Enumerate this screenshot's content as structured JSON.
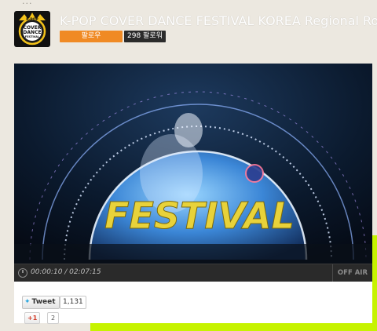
{
  "header": {
    "top_cut_text": "...",
    "channel_title": "K-POP COVER DANCE FESTIVAL KOREA Regional Ro",
    "follow_label": "팔로우",
    "follower_count": "298 팔로워"
  },
  "logo": {
    "text_line1": "K-POP",
    "text_line2": "COVER",
    "text_line3": "DANCE",
    "text_line4": "FESTIVAL",
    "ring_color": "#f2c21a"
  },
  "video": {
    "overlay_text": "FESTIVAL",
    "time": "00:00:10 / 02:07:15",
    "status": "OFF AIR"
  },
  "social": {
    "tweet_label": "Tweet",
    "tweet_count": "1,131",
    "gplus_label": "+1",
    "gplus_count": "2"
  },
  "colors": {
    "follow": "#f08a24",
    "accent_green": "#c6f300",
    "festival_yellow": "#e8d23a"
  }
}
